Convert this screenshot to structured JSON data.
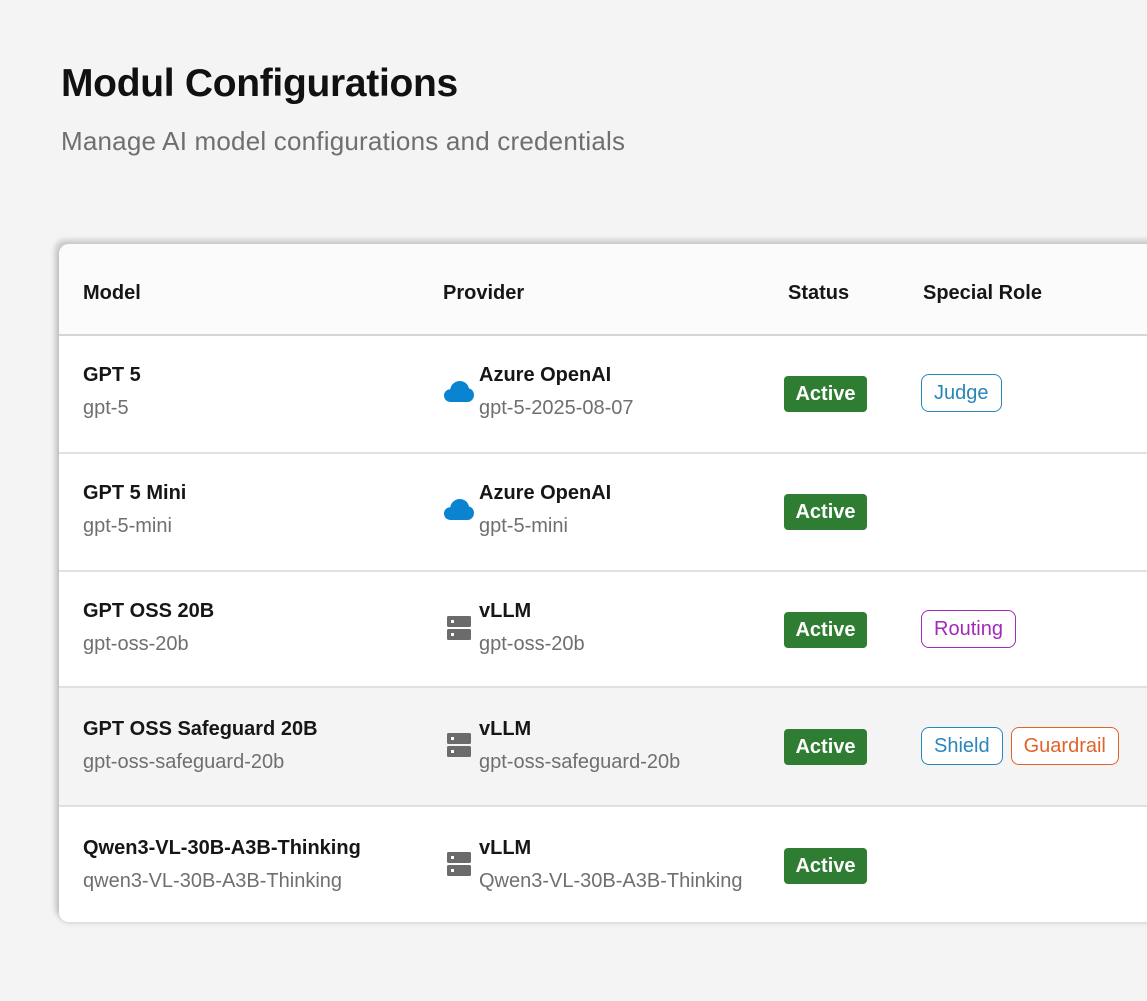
{
  "header": {
    "title": "Modul Configurations",
    "subtitle": "Manage AI model configurations and credentials"
  },
  "table": {
    "columns": {
      "model": "Model",
      "provider": "Provider",
      "status": "Status",
      "role": "Special Role"
    },
    "rows": [
      {
        "name": "GPT 5",
        "id": "gpt-5",
        "provider": "Azure OpenAI",
        "provider_icon": "cloud-icon",
        "deployment": "gpt-5-2025-08-07",
        "status": "Active",
        "roles": [
          {
            "label": "Judge",
            "color": "#2a86b8"
          }
        ]
      },
      {
        "name": "GPT 5 Mini",
        "id": "gpt-5-mini",
        "provider": "Azure OpenAI",
        "provider_icon": "cloud-icon",
        "deployment": "gpt-5-mini",
        "status": "Active",
        "roles": []
      },
      {
        "name": "GPT OSS 20B",
        "id": "gpt-oss-20b",
        "provider": "vLLM",
        "provider_icon": "server-icon",
        "deployment": "gpt-oss-20b",
        "status": "Active",
        "roles": [
          {
            "label": "Routing",
            "color": "#a22ab8"
          }
        ]
      },
      {
        "name": "GPT OSS Safeguard 20B",
        "id": "gpt-oss-safeguard-20b",
        "provider": "vLLM",
        "provider_icon": "server-icon",
        "deployment": "gpt-oss-safeguard-20b",
        "status": "Active",
        "roles": [
          {
            "label": "Shield",
            "color": "#2a86b8"
          },
          {
            "label": "Guardrail",
            "color": "#e0632a"
          }
        ]
      },
      {
        "name": "Qwen3-VL-30B-A3B-Thinking",
        "id": "qwen3-VL-30B-A3B-Thinking",
        "provider": "vLLM",
        "provider_icon": "server-icon",
        "deployment": "Qwen3-VL-30B-A3B-Thinking",
        "status": "Active",
        "roles": []
      }
    ]
  },
  "colors": {
    "status_active": "#2e7d32",
    "cloud_icon": "#0a84d0",
    "server_icon": "#6b6b6b"
  }
}
